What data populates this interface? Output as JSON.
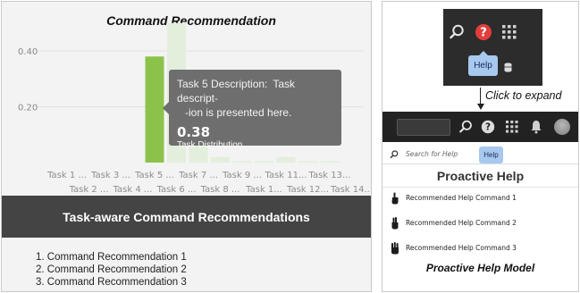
{
  "left_panel": {
    "banner_title": "Task-aware Command Recommendations",
    "recommendations": [
      "1. Command Recommendation 1",
      "2. Command Recommendation 2",
      "3. Command Recommendation 3"
    ],
    "tooltip": {
      "label": "Task 5 Description:",
      "description": "Task descript- -ion is presented here.",
      "desc_line1": "Task descript-",
      "desc_line2": "-ion is presented here.",
      "value": "0.38",
      "value_label": "Task Distribution"
    }
  },
  "chart_data": {
    "type": "bar",
    "title": "Command Recommendation",
    "categories": [
      "Task 1 ...",
      "Task 2 ...",
      "Task 3 ...",
      "Task 4 ...",
      "Task 5 ...",
      "Task 6 ...",
      "Task 7 ...",
      "Task 8 ...",
      "Task 9 ...",
      "Task 1...",
      "Task 11...",
      "Task 12...",
      "Task 13...",
      "Task 14..."
    ],
    "values": [
      0,
      0,
      0,
      0,
      0.38,
      0.5,
      0.1,
      0.02,
      0.005,
      0.005,
      0.02,
      0.005,
      0.005,
      0
    ],
    "highlighted_index": 4,
    "yticks": [
      "0.40",
      "0.20"
    ],
    "ylim": [
      0,
      0.5
    ],
    "xlabel": "",
    "ylabel": "",
    "grid": true,
    "colors": {
      "highlight": "#8bc34a",
      "faded": "#e3eedd"
    }
  },
  "right_panel": {
    "top_help_tooltip": "Help",
    "expand_label": "Click to expand",
    "search_placeholder": "Search for Help",
    "help_tooltip": "Help",
    "proactive_title": "Proactive Help",
    "commands": [
      "Recommended Help Command 1",
      "Recommended Help Command 2",
      "Recommended Help Command 3"
    ],
    "caption": "Proactive Help Model",
    "icons": [
      "search-icon",
      "help-icon",
      "apps-grid-icon",
      "bell-icon",
      "avatar",
      "database-icon",
      "hand-one-finger-icon",
      "hand-two-fingers-icon",
      "hand-three-fingers-icon"
    ],
    "colors": {
      "help_red": "#e23d3d",
      "tooltip_blue": "#a7c8ef",
      "dark": "#2c2c2c"
    }
  }
}
